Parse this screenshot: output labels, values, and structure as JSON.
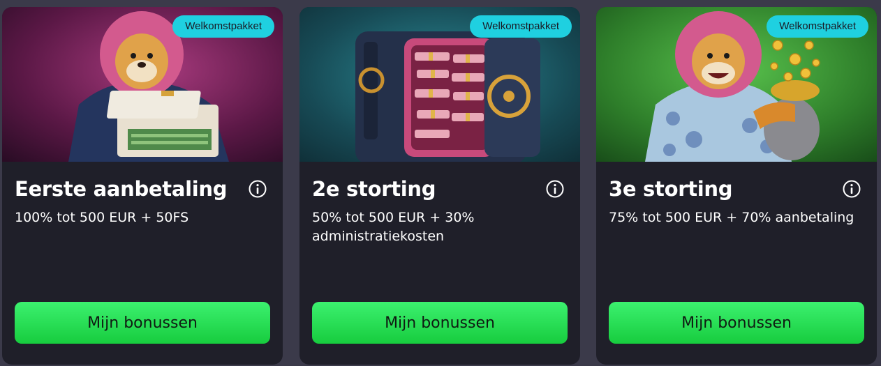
{
  "cards": [
    {
      "badge": "Welkomstpakket",
      "title": "Eerste aanbetaling",
      "description": "100% tot 500 EUR + 50FS",
      "button": "Mijn bonussen",
      "info_icon": "info-icon",
      "image_theme": "lion-with-cash-briefcase",
      "colors": {
        "bg": "#6b1f52"
      }
    },
    {
      "badge": "Welkomstpakket",
      "title": "2e storting",
      "description": "50% tot 500 EUR + 30% administratiekosten",
      "button": "Mijn bonussen",
      "info_icon": "info-icon",
      "image_theme": "safe-with-money",
      "colors": {
        "bg": "#17505a"
      }
    },
    {
      "badge": "Welkomstpakket",
      "title": "3e storting",
      "description": "75% tot 500 EUR + 70% aanbetaling",
      "button": "Mijn bonussen",
      "info_icon": "info-icon",
      "image_theme": "lion-with-coin-bag",
      "colors": {
        "bg": "#2f8a2a"
      }
    }
  ],
  "colors": {
    "page_bg": "#3b3a4a",
    "card_bg": "#1f1f29",
    "badge_bg": "#1fd0e0",
    "button_green": "#2ee35a"
  }
}
